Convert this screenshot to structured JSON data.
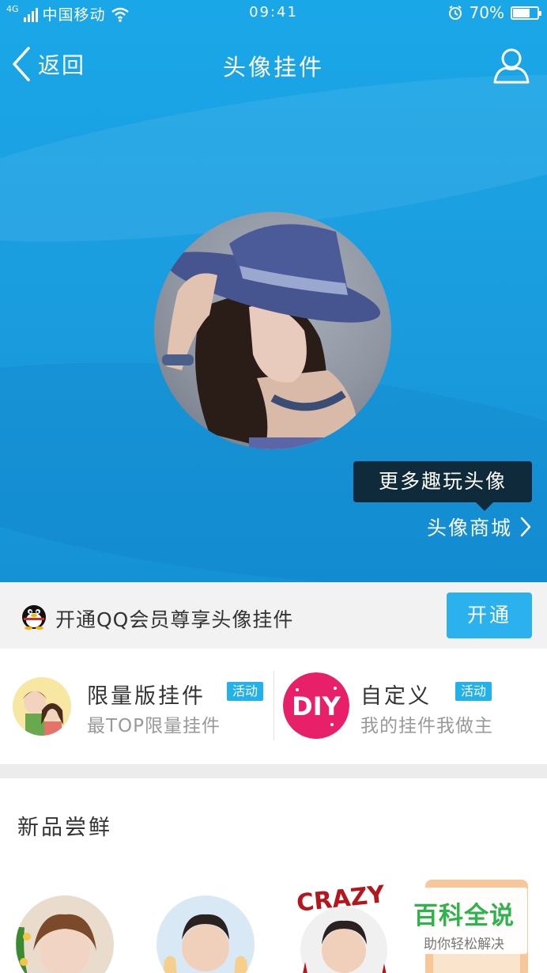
{
  "status_bar": {
    "network": "4G",
    "carrier": "中国移动",
    "time": "09:41",
    "battery": "70%",
    "battery_level": 0.7
  },
  "nav": {
    "back_label": "返回",
    "title": "头像挂件"
  },
  "hero": {
    "tooltip": "更多趣玩头像",
    "mall_link": "头像商城"
  },
  "vip": {
    "text": "开通QQ会员尊享头像挂件",
    "button": "开通"
  },
  "features": [
    {
      "title": "限量版挂件",
      "badge": "活动",
      "subtitle": "最TOP限量挂件"
    },
    {
      "title": "自定义",
      "badge": "活动",
      "subtitle": "我的挂件我做主",
      "icon_text": "DIY"
    }
  ],
  "new_section": {
    "title": "新品尝鲜",
    "thumb_text": "CRAZY"
  },
  "watermark": {
    "title": "百科全说",
    "subtitle": "助你轻松解决"
  },
  "colors": {
    "hero_blue": "#1b9ee0",
    "button_blue": "#2bb2ee",
    "badge_blue": "#23b1ea",
    "tooltip_bg": "#0f2a3a",
    "watermark_green": "#2fb34a"
  }
}
